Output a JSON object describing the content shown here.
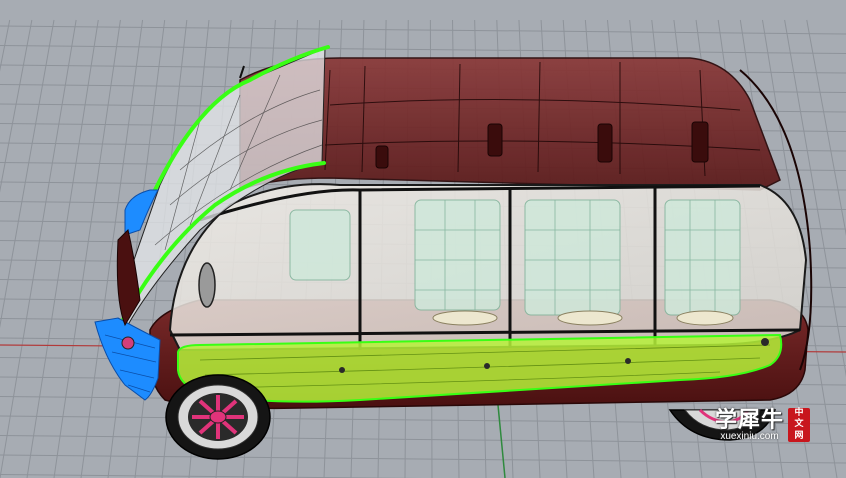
{
  "viewport": {
    "background_color": "#a7acb3",
    "grid_color": "#8e939a",
    "axis_x_color": "#b23a3a",
    "axis_y_color": "#2f8a3e"
  },
  "model": {
    "body_color": "#5a1616",
    "glass_tint": "#e9e4dc",
    "selection_green": "#39ff14",
    "selection_yellowgreen": "#b6f23a",
    "selection_blue": "#1d8cff",
    "wheel_accent": "#e0337a"
  },
  "watermark": {
    "title": "学犀牛",
    "domain": "xuexiniu.com",
    "badge_line1": "中",
    "badge_line2": "文",
    "badge_line3": "网"
  }
}
